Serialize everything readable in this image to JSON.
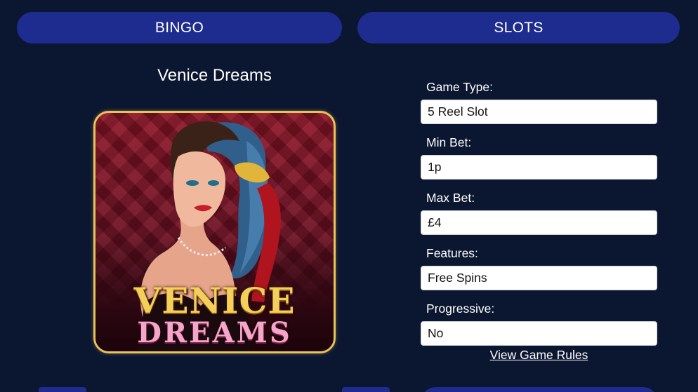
{
  "nav": {
    "bingo_label": "BINGO",
    "slots_label": "SLOTS"
  },
  "game": {
    "title": "Venice Dreams",
    "art_logo_line1": "VENICE",
    "art_logo_line2": "DREAMS"
  },
  "details": {
    "game_type_label": "Game Type:",
    "game_type_value": "5 Reel Slot",
    "min_bet_label": "Min Bet:",
    "min_bet_value": "1p",
    "max_bet_label": "Max Bet:",
    "max_bet_value": "£4",
    "features_label": "Features:",
    "features_value": "Free Spins",
    "progressive_label": "Progressive:",
    "progressive_value": "No"
  },
  "links": {
    "view_rules": "View Game Rules"
  },
  "colors": {
    "background": "#0b1630",
    "nav_pill": "#1e2c8f",
    "art_border": "#e8c35a"
  }
}
